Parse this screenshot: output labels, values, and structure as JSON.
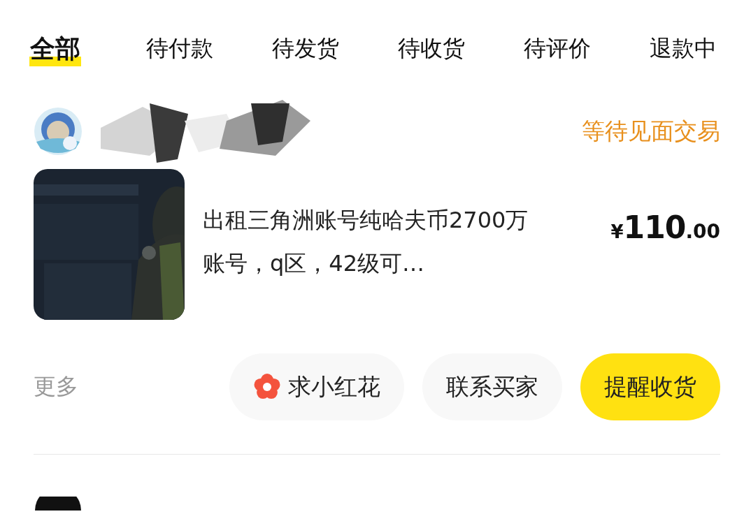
{
  "tabs": [
    {
      "label": "全部",
      "selected": true
    },
    {
      "label": "待付款",
      "selected": false
    },
    {
      "label": "待发货",
      "selected": false
    },
    {
      "label": "待收货",
      "selected": false
    },
    {
      "label": "待评价",
      "selected": false
    },
    {
      "label": "退款中",
      "selected": false
    }
  ],
  "order": {
    "status": "等待见面交易",
    "product": {
      "title": "出租三角洲账号纯哈夫币2700万账号，q区，42级可…",
      "price": {
        "currency": "¥",
        "integer": "110",
        "decimal": ".00"
      }
    },
    "more": "更多",
    "actions": [
      {
        "label": "求小红花",
        "kind": "flower"
      },
      {
        "label": "联系买家",
        "kind": "plain"
      },
      {
        "label": "提醒收货",
        "kind": "primary"
      }
    ]
  }
}
